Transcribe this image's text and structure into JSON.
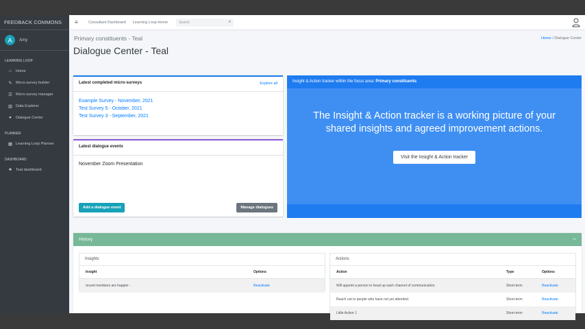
{
  "sidebar": {
    "brand": "FEEDBACK COMMONS",
    "user": {
      "initial": "A",
      "name": "Amy"
    },
    "sections": [
      {
        "header": "LEARNING LOOP",
        "items": [
          {
            "label": "Home",
            "icon": "home-icon"
          },
          {
            "label": "Micro-survey builder",
            "icon": "wrench-icon"
          },
          {
            "label": "Micro-survey manager",
            "icon": "list-icon"
          },
          {
            "label": "Data Explorer",
            "icon": "chart-icon"
          },
          {
            "label": "Dialogue Center",
            "icon": "comments-icon"
          }
        ]
      },
      {
        "header": "PLANNER",
        "items": [
          {
            "label": "Learning Loop Planner",
            "icon": "calendar-icon"
          }
        ]
      },
      {
        "header": "DASHBOARD",
        "items": [
          {
            "label": "Teal dashboard",
            "icon": "people-icon"
          }
        ]
      }
    ]
  },
  "topbar": {
    "links": [
      "Consultant Dashboard",
      "Learning Loop Home"
    ],
    "search_placeholder": "Search"
  },
  "page": {
    "subtitle": "Primary constituents - Teal",
    "title": "Dialogue Center - Teal",
    "breadcrumb": {
      "home": "Home",
      "sep": "/",
      "current": "Dialogue Center"
    }
  },
  "surveys_card": {
    "title": "Latest completed micro-surveys",
    "explore": "Explore all",
    "items": [
      "Example Survey - November, 2021",
      "Test Survey 5 - October, 2021",
      "Test Survey 3 - September, 2021"
    ]
  },
  "events_card": {
    "title": "Latest dialogue events",
    "items": [
      "November Zoom Presentation"
    ],
    "add_button": "Add a dialogue event",
    "manage_button": "Manage dialogues"
  },
  "tracker": {
    "head_prefix": "Insight & Action tracker within the focus area:",
    "focus_area": "Primary constituents",
    "text": "The Insight & Action tracker is a working picture of your shared insights and agreed improvement actions.",
    "button": "Visit the Insight & Action tracker"
  },
  "history": {
    "title": "History",
    "collapse": "–",
    "insights": {
      "title": "Insights",
      "columns": [
        "Insight",
        "Options"
      ],
      "rows": [
        {
          "insight": "recent members are happier -",
          "option": "Reactivate"
        }
      ]
    },
    "actions": {
      "title": "Actions",
      "columns": [
        "Action",
        "Type",
        "Options"
      ],
      "rows": [
        {
          "action": "Will appoint a person to head up each channel of communication.",
          "type": "Short-term",
          "option": "Reactivate"
        },
        {
          "action": "Reach out to people who have not yet attended.",
          "type": "Short-term",
          "option": "Reactivate"
        },
        {
          "action": "Little Action 1",
          "type": "Short-term",
          "option": "Reactivate"
        }
      ]
    }
  },
  "colors": {
    "sidebar": "#343a40",
    "tracker": "#3f8ff3",
    "history_header": "#76b898",
    "teal_button": "#17a2b8",
    "link": "#007bff"
  }
}
